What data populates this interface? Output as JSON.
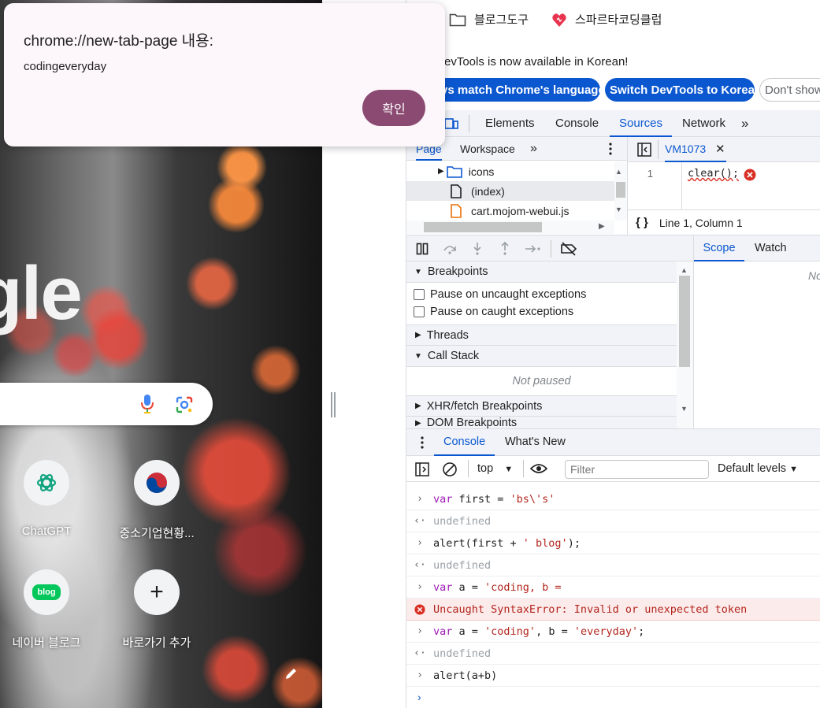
{
  "dialog": {
    "title": "chrome://new-tab-page 내용:",
    "message": "codingeveryday",
    "ok_label": "확인"
  },
  "bookmarks": [
    {
      "label": "블로그도구",
      "icon": "folder-icon"
    },
    {
      "label": "스파르타코딩클럽",
      "icon": "sparta-logo-icon"
    }
  ],
  "ntp": {
    "logo_fragment": "gle",
    "shortcuts": [
      {
        "label": "ChatGPT",
        "icon": "chatgpt-icon"
      },
      {
        "label": "중소기업현황...",
        "icon": "korea-flag-icon"
      },
      {
        "label": "네이버 블로그",
        "icon": "naver-blog-icon",
        "icon_text": "blog"
      },
      {
        "label": "바로가기 추가",
        "icon": "plus-icon",
        "icon_text": "+"
      }
    ]
  },
  "devtools": {
    "infobar": {
      "text": "evTools is now available in Korean!",
      "btn_match": "ys match Chrome's language",
      "btn_switch": "Switch DevTools to Korean",
      "btn_dont": "Don't show"
    },
    "tabs": [
      "Elements",
      "Console",
      "Sources",
      "Network"
    ],
    "active_tab": "Sources",
    "navigator": {
      "tabs": [
        "Page",
        "Workspace"
      ],
      "tree": [
        {
          "label": "icons",
          "type": "folder"
        },
        {
          "label": "(index)",
          "type": "file"
        },
        {
          "label": "cart.mojom-webui.js",
          "type": "js"
        }
      ]
    },
    "editor": {
      "file_tab": "VM1073",
      "line_number": "1",
      "code": "clear();",
      "status": "Line 1, Column 1"
    },
    "debugger": {
      "sections": {
        "breakpoints": "Breakpoints",
        "pause_uncaught": "Pause on uncaught exceptions",
        "pause_caught": "Pause on caught exceptions",
        "threads": "Threads",
        "call_stack": "Call Stack",
        "not_paused": "Not paused",
        "xhr": "XHR/fetch Breakpoints",
        "dom": "DOM Breakpoints"
      },
      "scope_tabs": [
        "Scope",
        "Watch"
      ],
      "scope_placeholder": "No"
    },
    "console": {
      "tabs": [
        "Console",
        "What's New"
      ],
      "context": "top",
      "filter_placeholder": "Filter",
      "levels": "Default levels",
      "lines": [
        {
          "kind": "input",
          "parts": [
            [
              "kw",
              "var"
            ],
            [
              "vr",
              " first = "
            ],
            [
              "str",
              "'bs\\'s'"
            ]
          ]
        },
        {
          "kind": "result",
          "text": "undefined"
        },
        {
          "kind": "input",
          "parts": [
            [
              "vr",
              "alert(first + "
            ],
            [
              "str",
              "' blog'"
            ],
            [
              "vr",
              ");"
            ]
          ]
        },
        {
          "kind": "result",
          "text": "undefined"
        },
        {
          "kind": "input",
          "parts": [
            [
              "kw",
              "var"
            ],
            [
              "vr",
              " a = "
            ],
            [
              "str",
              "'coding, b ="
            ]
          ]
        },
        {
          "kind": "error",
          "text": "Uncaught SyntaxError: Invalid or unexpected token"
        },
        {
          "kind": "input",
          "parts": [
            [
              "kw",
              "var"
            ],
            [
              "vr",
              " a = "
            ],
            [
              "str",
              "'coding'"
            ],
            [
              "vr",
              ", b = "
            ],
            [
              "str",
              "'everyday'"
            ],
            [
              "vr",
              ";"
            ]
          ]
        },
        {
          "kind": "result",
          "text": "undefined"
        },
        {
          "kind": "input",
          "parts": [
            [
              "vr",
              "alert(a+b)"
            ]
          ]
        }
      ]
    }
  },
  "colors": {
    "accent": "#0b57d0",
    "dialog_button": "#8b4a72",
    "error": "#d93025"
  }
}
